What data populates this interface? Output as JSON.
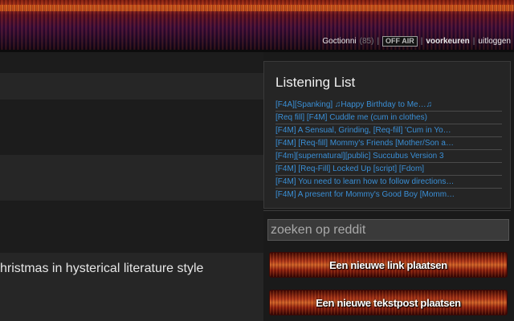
{
  "header": {
    "username": "Goctionni",
    "karma": "(85)",
    "status_badge": "OFF AIR",
    "preferences": "voorkeuren",
    "logout": "uitloggen",
    "separator": "|"
  },
  "main": {
    "visible_post_title": "hristmas in hysterical literature style"
  },
  "sidebar": {
    "listening_list": {
      "title": "Listening List",
      "items": [
        "[F4A][Spanking] ♫Happy Birthday to Me…♫",
        "[Req fill] [F4M] Cuddle me (cum in clothes)",
        "[F4M] A Sensual, Grinding, [Req-fill] 'Cum in Yo…",
        "[F4M] [Req-fill] Mommy's Friends [Mother/Son a…",
        "[F4m][supernatural][public] Succubus Version 3",
        "[F4M] [Req-Fill] Locked Up [script] [Fdom]",
        "[F4M] You need to learn how to follow directions…",
        "[F4M] A present for Mommy's Good Boy [Momm…"
      ]
    },
    "search": {
      "placeholder": "zoeken op reddit"
    },
    "new_link_button": "Een nieuwe link plaatsen",
    "new_text_button": "Een nieuwe tekstpost plaatsen"
  },
  "colors": {
    "link": "#3a8fd6",
    "background": "#1a1a1a",
    "button_accent": "#b5361a"
  }
}
